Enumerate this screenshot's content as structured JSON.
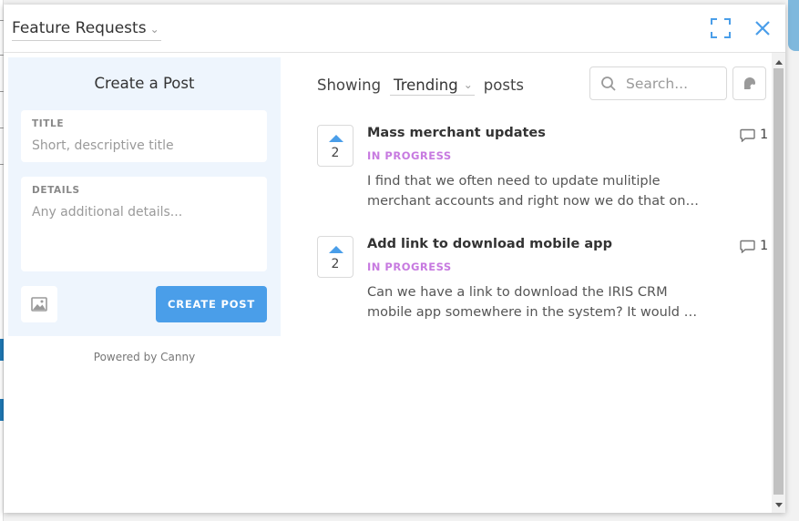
{
  "header": {
    "board_name": "Feature Requests"
  },
  "create_post": {
    "heading": "Create a Post",
    "title_label": "TITLE",
    "title_placeholder": "Short, descriptive title",
    "details_label": "DETAILS",
    "details_placeholder": "Any additional details...",
    "submit_label": "CREATE POST",
    "powered_by": "Powered by Canny"
  },
  "list": {
    "showing_prefix": "Showing",
    "sort_value": "Trending",
    "showing_suffix": "posts",
    "search_placeholder": "Search..."
  },
  "posts": [
    {
      "votes": "2",
      "title": "Mass merchant updates",
      "status": "IN PROGRESS",
      "body_line1": "I find that we often need to update mulitiple",
      "body_line2": "merchant accounts and right now we do that one by one",
      "comments": "1"
    },
    {
      "votes": "2",
      "title": "Add link to download mobile app",
      "status": "IN PROGRESS",
      "body_line1": "Can we have a link to download the IRIS CRM",
      "body_line2": "mobile app somewhere in the system? It would make things easier",
      "comments": "1"
    }
  ],
  "colors": {
    "accent": "#4a9ee9",
    "status": "#c77ae0",
    "panel_bg": "#eef5fd"
  }
}
